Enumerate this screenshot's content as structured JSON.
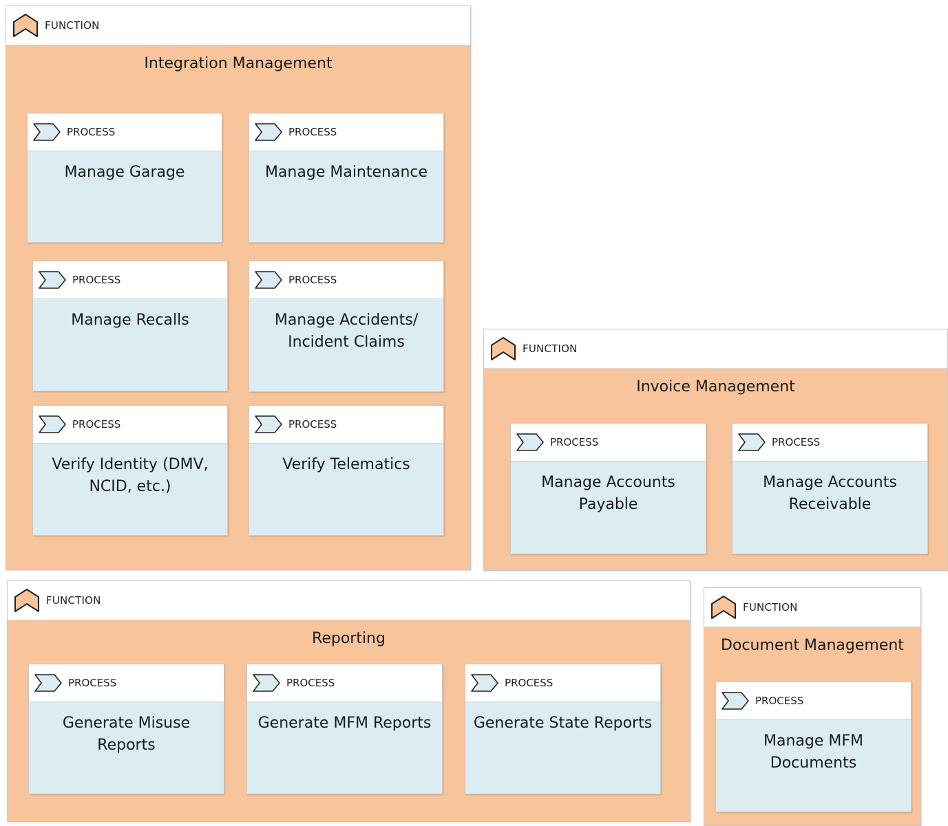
{
  "labels": {
    "function_tag": "FUNCTION",
    "process_tag": "PROCESS"
  },
  "colors": {
    "function_fill": "#f8c49b",
    "process_fill": "#dbecf3",
    "function_icon_fill": "#f8c49b",
    "process_icon_fill": "#dbecf3"
  },
  "functions": {
    "integration": {
      "title": "Integration Management",
      "processes": {
        "garage": {
          "lines": [
            "Manage Garage"
          ]
        },
        "maintenance": {
          "lines": [
            "Manage Maintenance"
          ]
        },
        "recalls": {
          "lines": [
            "Manage Recalls"
          ]
        },
        "accidents": {
          "lines": [
            "Manage Accidents/",
            "Incident Claims"
          ]
        },
        "identity": {
          "lines": [
            "Verify Identity (DMV,",
            "NCID, etc.)"
          ]
        },
        "telematics": {
          "lines": [
            "Verify Telematics"
          ]
        }
      }
    },
    "invoice": {
      "title": "Invoice Management",
      "processes": {
        "payable": {
          "lines": [
            "Manage Accounts",
            "Payable"
          ]
        },
        "receivable": {
          "lines": [
            "Manage Accounts",
            "Receivable"
          ]
        }
      }
    },
    "reporting": {
      "title": "Reporting",
      "processes": {
        "misuse": {
          "lines": [
            "Generate Misuse",
            "Reports"
          ]
        },
        "mfm": {
          "lines": [
            "Generate MFM Reports"
          ]
        },
        "state": {
          "lines": [
            "Generate State Reports"
          ]
        }
      }
    },
    "document": {
      "title": "Document Management",
      "processes": {
        "mfm_docs": {
          "lines": [
            "Manage MFM",
            "Documents"
          ]
        }
      }
    }
  }
}
